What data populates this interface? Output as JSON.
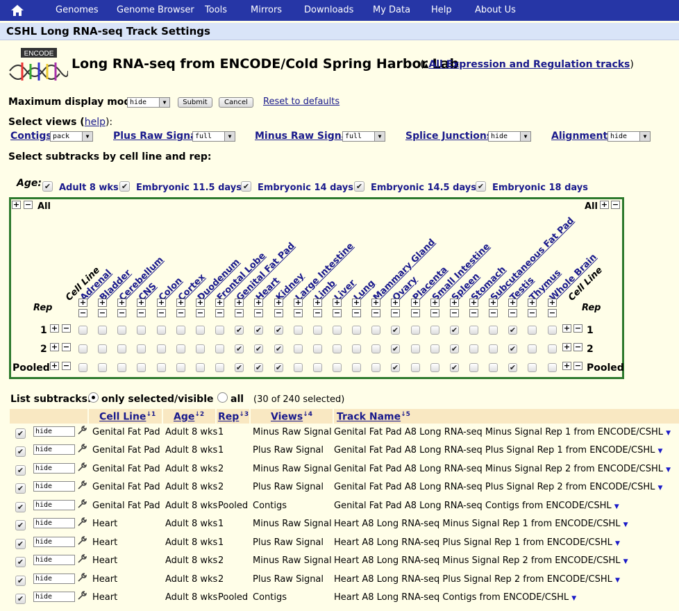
{
  "nav": {
    "items": [
      "Genomes",
      "Genome Browser",
      "Tools",
      "Mirrors",
      "Downloads",
      "My Data",
      "Help",
      "About Us"
    ]
  },
  "page": {
    "title": "CSHL Long RNA-seq Track Settings",
    "logo_text": "ENCODE",
    "heading": "Long RNA-seq from ENCODE/Cold Spring Harbor Lab",
    "all_tracks_link": "All Expression and Regulation tracks",
    "paren_open": "(",
    "paren_close": ")",
    "up_arrow": "▲"
  },
  "display": {
    "label": "Maximum display mode:",
    "value": "hide",
    "submit": "Submit",
    "cancel": "Cancel",
    "reset": "Reset to defaults"
  },
  "views": {
    "label": "Select views (",
    "help": "help",
    "label_end": "):",
    "items": [
      {
        "name": "Contigs",
        "value": "pack"
      },
      {
        "name": "Plus Raw Signal",
        "value": "full"
      },
      {
        "name": "Minus Raw Signal",
        "value": "full"
      },
      {
        "name": "Splice Junctions",
        "value": "hide"
      },
      {
        "name": "Alignments",
        "value": "hide"
      }
    ]
  },
  "subtracks": {
    "label": "Select subtracks by cell line and rep:",
    "age_label": "Age:",
    "ages": [
      "Adult 8 wks",
      "Embryonic 11.5 days",
      "Embryonic 14 days",
      "Embryonic 14.5 days",
      "Embryonic 18 days"
    ],
    "all": "All",
    "cell_line_header": "Cell Line",
    "rep_header": "Rep",
    "columns": [
      "Adrenal",
      "Bladder",
      "Cerebellum",
      "CNS",
      "Colon",
      "Cortex",
      "Duodenum",
      "Frontal Lobe",
      "Genital Fat Pad",
      "Heart",
      "Kidney",
      "Large Intestine",
      "Limb",
      "Liver",
      "Lung",
      "Mammary Gland",
      "Ovary",
      "Placenta",
      "Small Intestine",
      "Spleen",
      "Stomach",
      "Subcutaneous Fat Pad",
      "Testis",
      "Thymus",
      "Whole Brain"
    ],
    "rows": [
      {
        "label": "1",
        "checked": [
          8,
          9,
          10,
          16,
          19,
          22
        ]
      },
      {
        "label": "2",
        "checked": [
          8,
          9,
          10,
          16,
          19,
          22
        ]
      },
      {
        "label": "Pooled",
        "checked": [
          8,
          9,
          10,
          16,
          19,
          22
        ]
      }
    ]
  },
  "list": {
    "label": "List subtracks:",
    "opt1": "only selected/visible",
    "opt2": "all",
    "count": "(30 of 240 selected)",
    "headers": [
      {
        "label": "Cell Line",
        "sort": "↓1"
      },
      {
        "label": "Age",
        "sort": "↓2"
      },
      {
        "label": "Rep",
        "sort": "↓3"
      },
      {
        "label": "Views",
        "sort": "↓4"
      },
      {
        "label": "Track Name",
        "sort": "↓5"
      }
    ],
    "rows": [
      {
        "vis": "hide",
        "cell": "Genital Fat Pad",
        "age": "Adult 8 wks",
        "rep": "1",
        "view": "Minus Raw Signal",
        "name": "Genital Fat Pad A8 Long RNA-seq Minus Signal Rep 1 from ENCODE/CSHL"
      },
      {
        "vis": "hide",
        "cell": "Genital Fat Pad",
        "age": "Adult 8 wks",
        "rep": "1",
        "view": "Plus Raw Signal",
        "name": "Genital Fat Pad A8 Long RNA-seq Plus Signal Rep 1 from ENCODE/CSHL"
      },
      {
        "vis": "hide",
        "cell": "Genital Fat Pad",
        "age": "Adult 8 wks",
        "rep": "2",
        "view": "Minus Raw Signal",
        "name": "Genital Fat Pad A8 Long RNA-seq Minus Signal Rep 2 from ENCODE/CSHL"
      },
      {
        "vis": "hide",
        "cell": "Genital Fat Pad",
        "age": "Adult 8 wks",
        "rep": "2",
        "view": "Plus Raw Signal",
        "name": "Genital Fat Pad A8 Long RNA-seq Plus Signal Rep 2 from ENCODE/CSHL"
      },
      {
        "vis": "hide",
        "cell": "Genital Fat Pad",
        "age": "Adult 8 wks",
        "rep": "Pooled",
        "view": "Contigs",
        "name": "Genital Fat Pad A8 Long RNA-seq Contigs from ENCODE/CSHL"
      },
      {
        "vis": "hide",
        "cell": "Heart",
        "age": "Adult 8 wks",
        "rep": "1",
        "view": "Minus Raw Signal",
        "name": "Heart A8 Long RNA-seq Minus Signal Rep 1 from ENCODE/CSHL"
      },
      {
        "vis": "hide",
        "cell": "Heart",
        "age": "Adult 8 wks",
        "rep": "1",
        "view": "Plus Raw Signal",
        "name": "Heart A8 Long RNA-seq Plus Signal Rep 1 from ENCODE/CSHL"
      },
      {
        "vis": "hide",
        "cell": "Heart",
        "age": "Adult 8 wks",
        "rep": "2",
        "view": "Minus Raw Signal",
        "name": "Heart A8 Long RNA-seq Minus Signal Rep 2 from ENCODE/CSHL"
      },
      {
        "vis": "hide",
        "cell": "Heart",
        "age": "Adult 8 wks",
        "rep": "2",
        "view": "Plus Raw Signal",
        "name": "Heart A8 Long RNA-seq Plus Signal Rep 2 from ENCODE/CSHL"
      },
      {
        "vis": "hide",
        "cell": "Heart",
        "age": "Adult 8 wks",
        "rep": "Pooled",
        "view": "Contigs",
        "name": "Heart A8 Long RNA-seq Contigs from ENCODE/CSHL"
      }
    ]
  },
  "colors": {
    "nav": "#2636a6",
    "titlebar": "#D9E4F8",
    "bg": "#FFFEE8",
    "matrix_border": "#2d7a2d",
    "link": "#1a1a8c"
  }
}
